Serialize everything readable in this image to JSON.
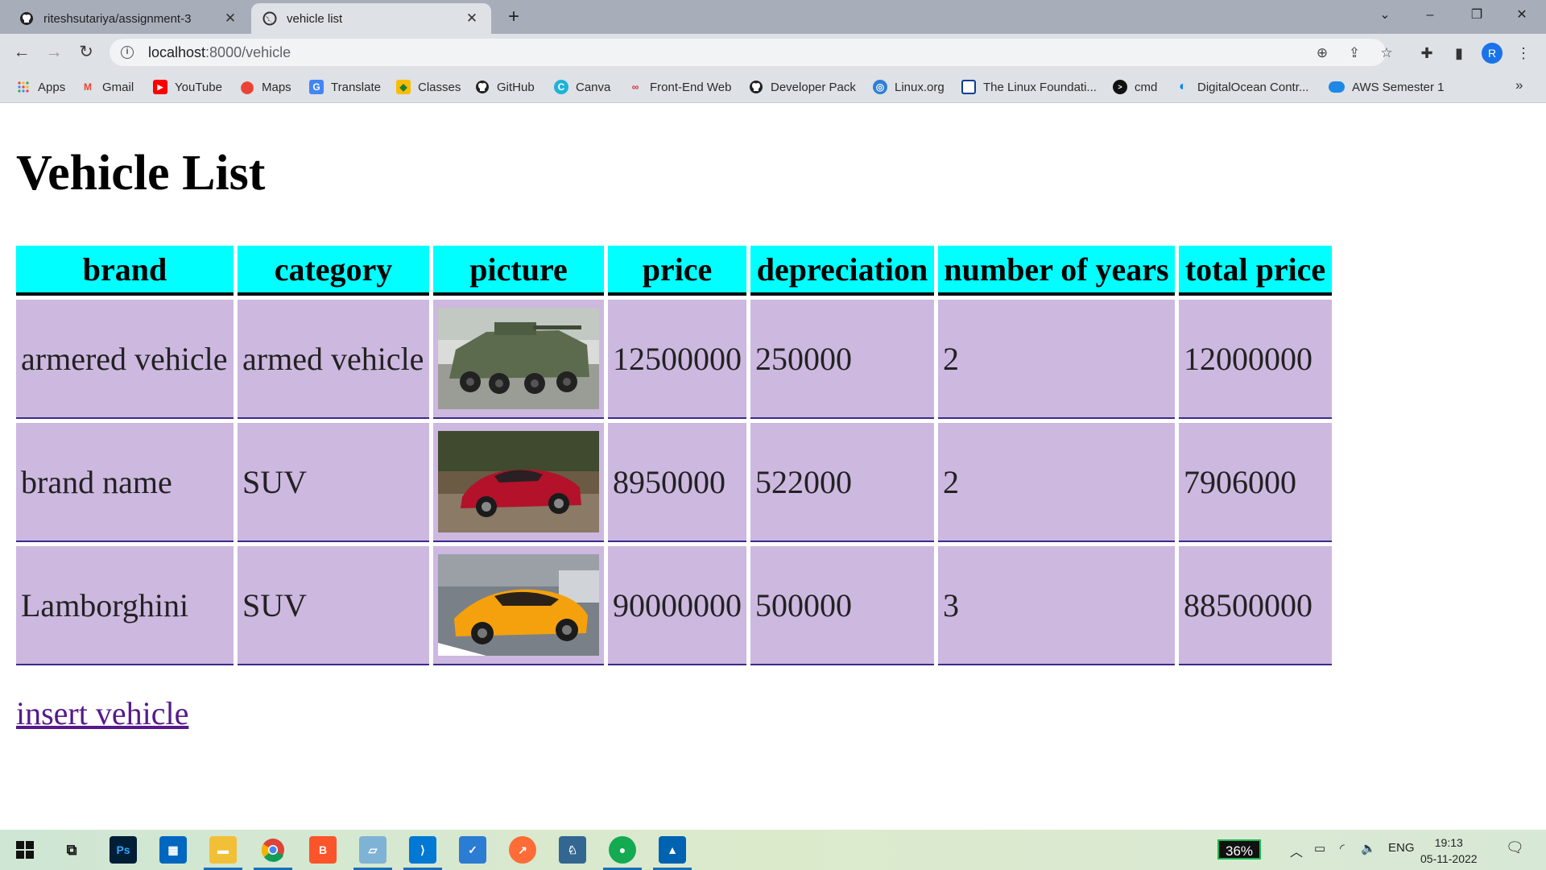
{
  "browser": {
    "tabs": [
      {
        "title": "riteshsutariya/assignment-3",
        "active": false,
        "icon": "github-icon"
      },
      {
        "title": "vehicle list",
        "active": true,
        "icon": "globe-icon"
      }
    ],
    "address": {
      "host": "localhost",
      "path": ":8000/vehicle"
    },
    "profile_initial": "R",
    "bookmarks": [
      {
        "label": "Apps",
        "icon": "apps-grid-icon"
      },
      {
        "label": "Gmail",
        "icon": "gmail-icon"
      },
      {
        "label": "YouTube",
        "icon": "youtube-icon"
      },
      {
        "label": "Maps",
        "icon": "maps-icon"
      },
      {
        "label": "Translate",
        "icon": "translate-icon"
      },
      {
        "label": "Classes",
        "icon": "classroom-icon"
      },
      {
        "label": "GitHub",
        "icon": "github-icon"
      },
      {
        "label": "Canva",
        "icon": "canva-icon"
      },
      {
        "label": "Front-End Web",
        "icon": "frontend-icon"
      },
      {
        "label": "Developer Pack",
        "icon": "github-icon"
      },
      {
        "label": "Linux.org",
        "icon": "linux-org-icon"
      },
      {
        "label": "The Linux Foundati...",
        "icon": "linux-foundation-icon"
      },
      {
        "label": "cmd",
        "icon": "cmd-icon"
      },
      {
        "label": "DigitalOcean Contr...",
        "icon": "digitalocean-icon"
      },
      {
        "label": "AWS Semester 1",
        "icon": "aws-icon"
      }
    ]
  },
  "page": {
    "title": "Vehicle List",
    "columns": [
      "brand",
      "category",
      "picture",
      "price",
      "depreciation",
      "number of years",
      "total price"
    ],
    "rows": [
      {
        "brand": "armered vehicle",
        "category": "armed vehicle",
        "picture": "armored-vehicle-photo",
        "price": "12500000",
        "depreciation": "250000",
        "years": "2",
        "total": "12000000"
      },
      {
        "brand": "brand name",
        "category": "SUV",
        "picture": "red-sports-car-photo",
        "price": "8950000",
        "depreciation": "522000",
        "years": "2",
        "total": "7906000"
      },
      {
        "brand": "Lamborghini",
        "category": "SUV",
        "picture": "yellow-lamborghini-photo",
        "price": "90000000",
        "depreciation": "500000",
        "years": "3",
        "total": "88500000"
      }
    ],
    "insert_link": "insert vehicle",
    "colors": {
      "header_bg": "#00ffff",
      "row_bg": "#cdb8e0",
      "link": "#551a8b"
    }
  },
  "taskbar": {
    "battery": "36%",
    "language": "ENG",
    "time": "19:13",
    "date": "05-11-2022"
  }
}
